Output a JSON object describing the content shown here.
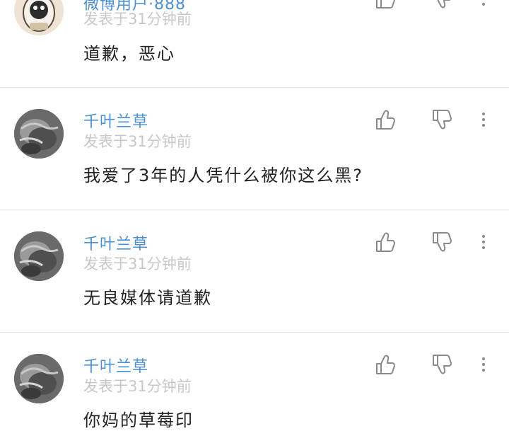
{
  "comments": [
    {
      "username": "微博用户·888",
      "timestamp": "发表于31分钟前",
      "text": "道歉，恶心"
    },
    {
      "username": "千叶兰草",
      "timestamp": "发表于31分钟前",
      "text": "我爱了3年的人凭什么被你这么黑?"
    },
    {
      "username": "千叶兰草",
      "timestamp": "发表于31分钟前",
      "text": "无良媒体请道歉"
    },
    {
      "username": "千叶兰草",
      "timestamp": "发表于31分钟前",
      "text": "你妈的草莓印"
    }
  ],
  "icons": {
    "like": "thumbs-up-outline-icon",
    "dislike": "thumbs-down-outline-icon",
    "more": "more-vertical-icon"
  },
  "colors": {
    "username": "#4a90d9",
    "timestamp": "#c7c7c7",
    "body_text": "#222222",
    "icon": "#8a8a8a",
    "divider": "#e6e6e6"
  }
}
